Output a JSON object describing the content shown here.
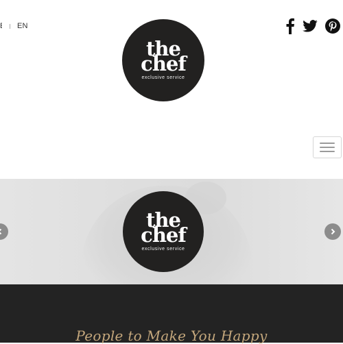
{
  "header": {
    "lang_previous": "E",
    "lang_current": "EN"
  },
  "social": {
    "icons": [
      "facebook-icon",
      "twitter-icon",
      "pinterest-icon"
    ]
  },
  "logo": {
    "line1": "the",
    "line2": "chef",
    "tagline": "exclusive service"
  },
  "hero": {
    "logo_line1": "the",
    "logo_line2": "chef",
    "logo_tagline": "exclusive service"
  },
  "band": {
    "tagline": "People to Make You Happy"
  },
  "colors": {
    "accent_gold": "#c4a77c",
    "logo_bg": "#222120",
    "band_bg": "#232323"
  }
}
